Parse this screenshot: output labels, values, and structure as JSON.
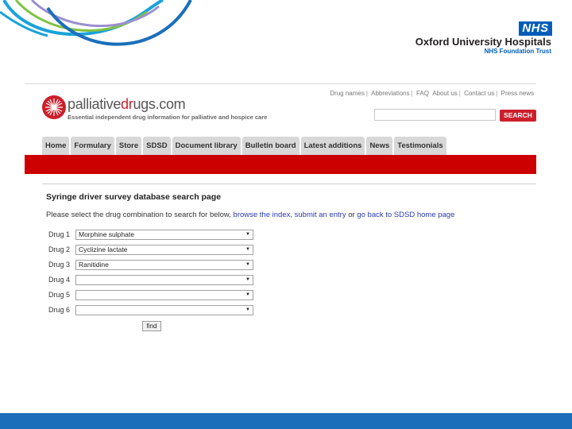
{
  "brand": {
    "nhs_badge": "NHS",
    "org_name": "Oxford University Hospitals",
    "org_sub": "NHS Foundation Trust",
    "nhs_blue": "#005eb8"
  },
  "site": {
    "logo_prefix": "palliative",
    "logo_accent": "dr",
    "logo_suffix": "ugs.com",
    "tagline": "Essential independent drug information for palliative and hospice care",
    "accent_color": "#cc1f2b",
    "top_links": [
      "Drug names",
      "Abbreviations",
      "FAQ",
      "About us",
      "Contact us",
      "Press news"
    ],
    "search_button": "SEARCH",
    "nav": [
      "Home",
      "Formulary",
      "Store",
      "SDSD",
      "Document library",
      "Bulletin board",
      "Latest additions",
      "News",
      "Testimonials"
    ]
  },
  "page": {
    "title": "Syringe driver survey database search page",
    "instructions_prefix": "Please select the drug combination to search for below,",
    "link_browse": "browse the index",
    "comma": ",",
    "link_submit": "submit an entry",
    "or_text": "or",
    "link_home": "go back to SDSD home page",
    "drugs": [
      {
        "label": "Drug 1",
        "value": "Morphine sulphate"
      },
      {
        "label": "Drug 2",
        "value": "Cyclizine lactate"
      },
      {
        "label": "Drug 3",
        "value": "Ranitidine"
      },
      {
        "label": "Drug 4",
        "value": ""
      },
      {
        "label": "Drug 5",
        "value": ""
      },
      {
        "label": "Drug 6",
        "value": ""
      }
    ],
    "find_button": "find"
  }
}
